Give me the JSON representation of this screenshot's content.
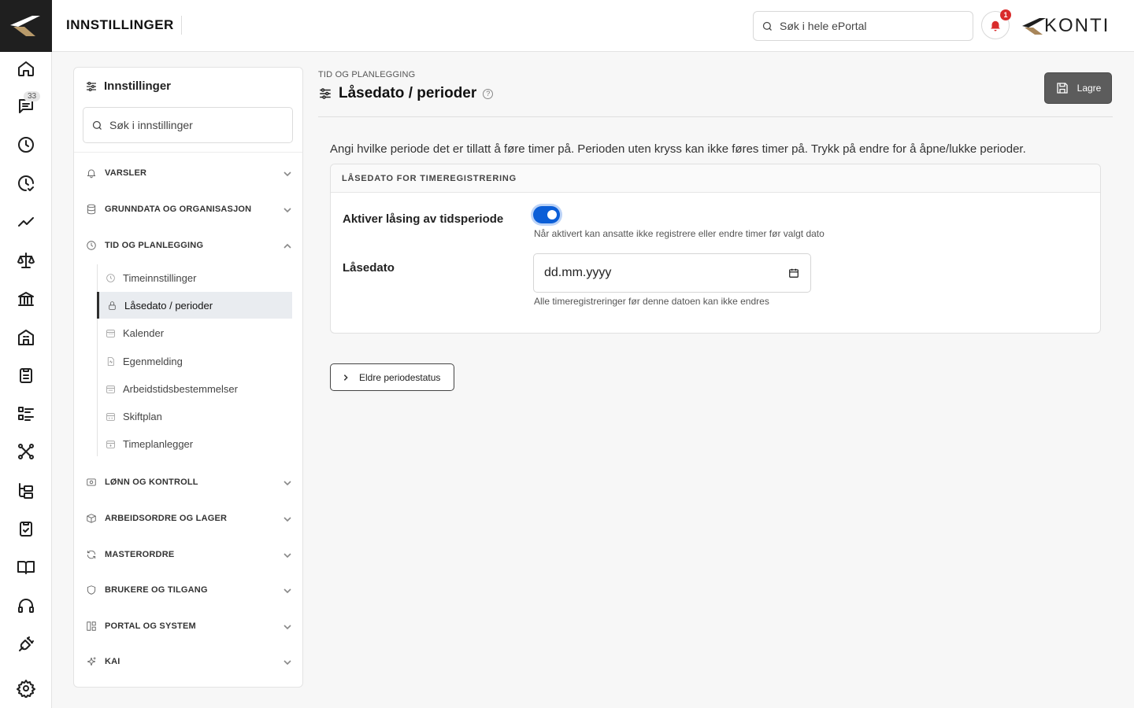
{
  "app": {
    "header_title": "INNSTILLINGER",
    "search_placeholder": "Søk i hele ePortal",
    "notification_count": "1",
    "brand_name": "KONTI"
  },
  "rail": {
    "icons": [
      "home-icon",
      "messages-icon",
      "clock-icon",
      "clock-check-icon",
      "trend-icon",
      "scale-icon",
      "bank-icon",
      "building-icon",
      "clipboard-icon",
      "list-icon",
      "network-icon",
      "tree-icon",
      "clipboard-check-icon",
      "book-icon",
      "headset-icon",
      "plug-icon",
      "gear-icon"
    ],
    "messages_badge": "33"
  },
  "settings_panel": {
    "title": "Innstillinger",
    "search_placeholder": "Søk i innstillinger",
    "sections": [
      {
        "label": "VARSLER",
        "icon": "bell-icon",
        "expanded": false
      },
      {
        "label": "GRUNNDATA OG ORGANISASJON",
        "icon": "database-icon",
        "expanded": false
      },
      {
        "label": "TID OG PLANLEGGING",
        "icon": "clock-icon",
        "expanded": true
      },
      {
        "label": "LØNN OG KONTROLL",
        "icon": "payroll-icon",
        "expanded": false
      },
      {
        "label": "ARBEIDSORDRE OG LAGER",
        "icon": "box-icon",
        "expanded": false
      },
      {
        "label": "MASTERORDRE",
        "icon": "refresh-icon",
        "expanded": false
      },
      {
        "label": "BRUKERE OG TILGANG",
        "icon": "shield-icon",
        "expanded": false
      },
      {
        "label": "PORTAL OG SYSTEM",
        "icon": "layout-icon",
        "expanded": false
      },
      {
        "label": "KAI",
        "icon": "sparkle-icon",
        "expanded": false
      }
    ],
    "subitems": [
      {
        "label": "Timeinnstillinger",
        "icon": "clock-icon",
        "active": false
      },
      {
        "label": "Låsedato / perioder",
        "icon": "lock-icon",
        "active": true
      },
      {
        "label": "Kalender",
        "icon": "calendar-icon",
        "active": false
      },
      {
        "label": "Egenmelding",
        "icon": "document-icon",
        "active": false
      },
      {
        "label": "Arbeidstidsbestemmelser",
        "icon": "calendar-rules-icon",
        "active": false
      },
      {
        "label": "Skiftplan",
        "icon": "calendar-shift-icon",
        "active": false
      },
      {
        "label": "Timeplanlegger",
        "icon": "calendar-plan-icon",
        "active": false
      }
    ]
  },
  "main": {
    "breadcrumb": "TID OG PLANLEGGING",
    "title": "Låsedato / perioder",
    "save_label": "Lagre",
    "intro": "Angi hvilke periode det er tillatt å føre timer på. Perioden uten kryss kan ikke føres timer på. Trykk på endre for å åpne/lukke perioder.",
    "card": {
      "header": "LÅSEDATO FOR TIMEREGISTRERING",
      "toggle_label": "Aktiver låsing av tidsperiode",
      "toggle_on": true,
      "toggle_hint": "Når aktivert kan ansatte ikke registrere eller endre timer før valgt dato",
      "date_label": "Låsedato",
      "date_placeholder": "dd.mm.yyyy",
      "date_hint": "Alle timeregistreringer før denne datoen kan ikke endres"
    },
    "older_button": "Eldre periodestatus"
  },
  "colors": {
    "accent": "#0b5ed7",
    "brand_gold": "#a8865a",
    "dark": "#1f1f1f",
    "save_button": "#5c5c5c"
  }
}
